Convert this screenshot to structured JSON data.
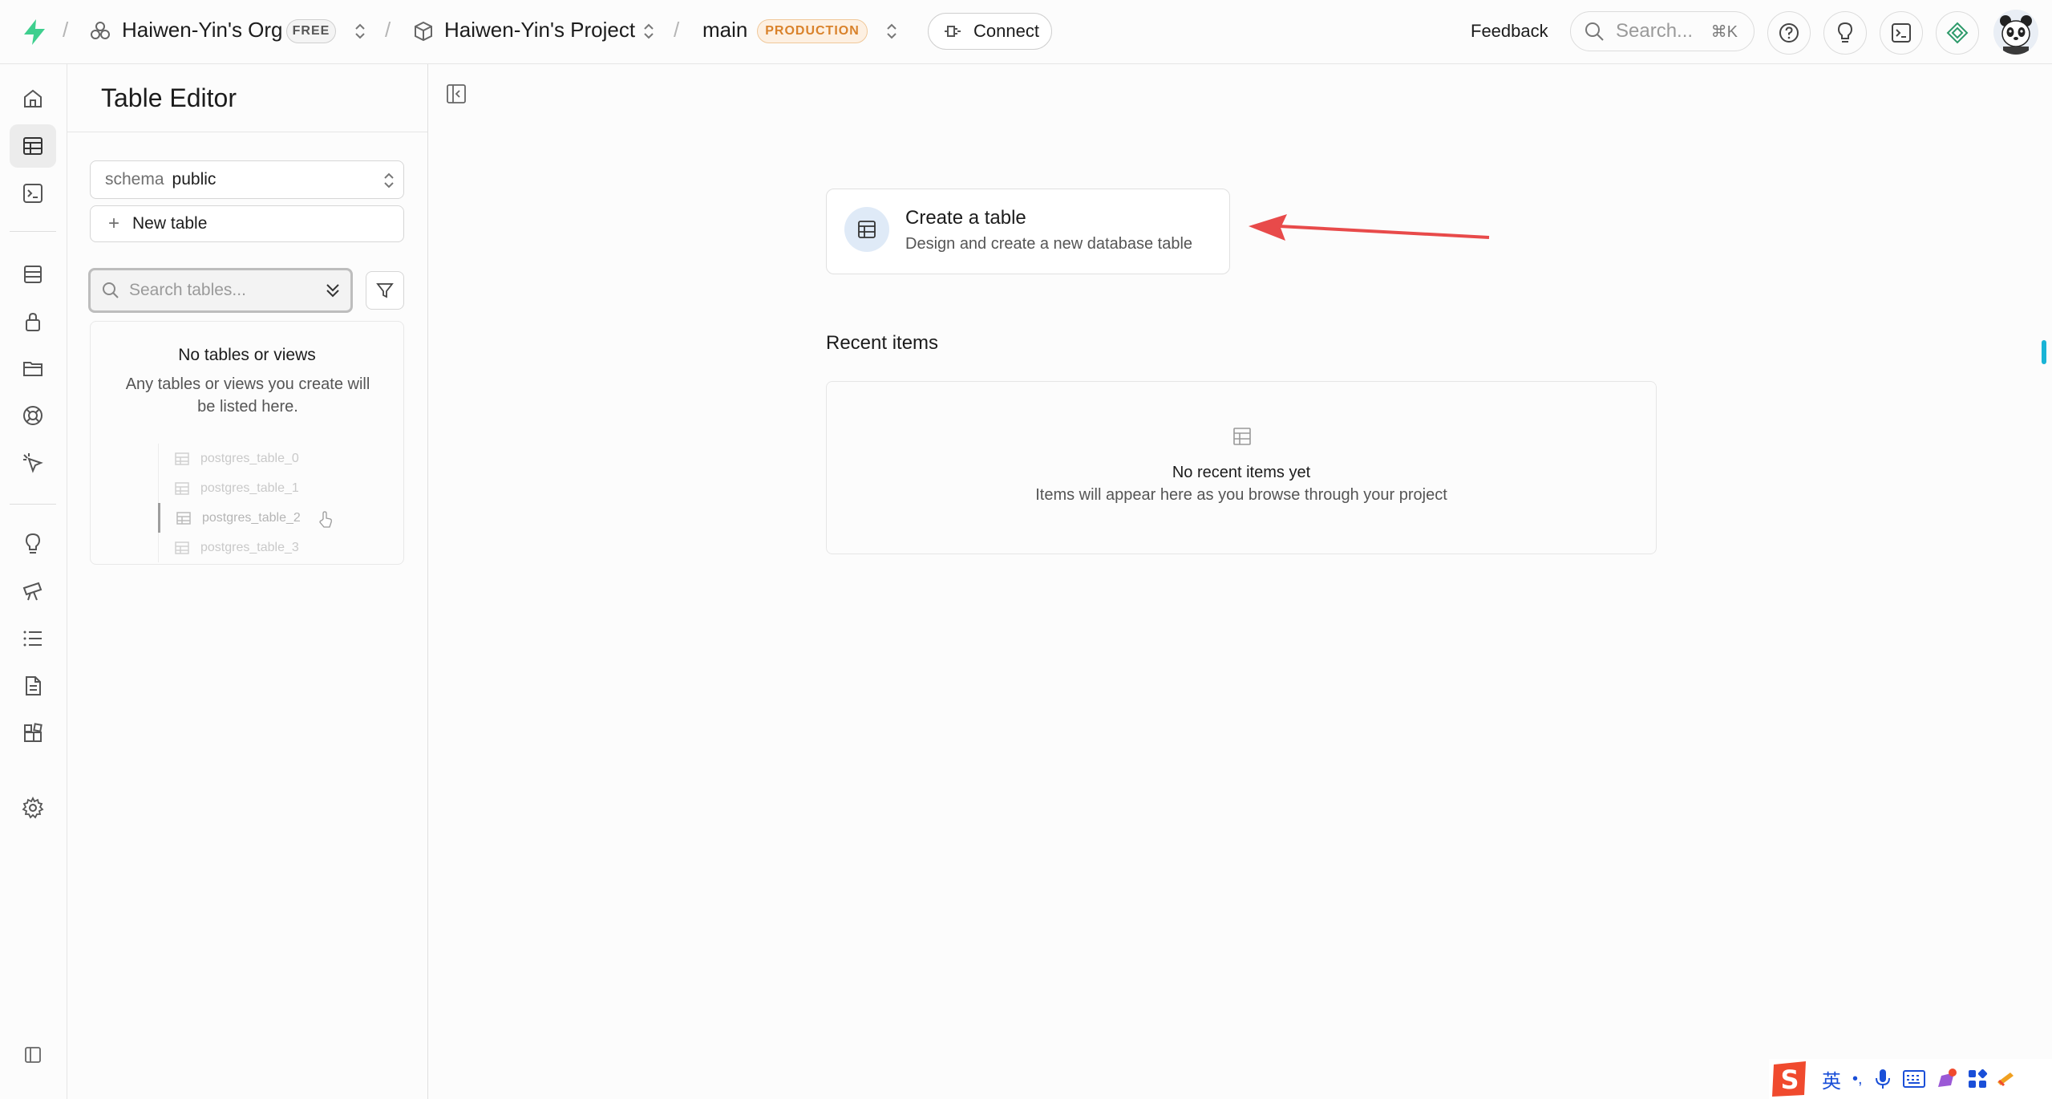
{
  "topbar": {
    "org_name": "Haiwen-Yin's Org",
    "org_plan": "FREE",
    "project_name": "Haiwen-Yin's Project",
    "branch_name": "main",
    "branch_env": "PRODUCTION",
    "connect_label": "Connect",
    "feedback_label": "Feedback",
    "search_placeholder": "Search...",
    "search_shortcut": "⌘K",
    "separator": "/"
  },
  "rail": {
    "items": [
      "home-icon",
      "table-editor-icon",
      "sql-editor-icon",
      "database-icon",
      "auth-icon",
      "storage-icon",
      "realtime-icon",
      "edge-functions-icon",
      "advisors-icon",
      "reports-icon",
      "logs-icon",
      "api-docs-icon",
      "integrations-icon",
      "settings-icon"
    ],
    "active": "table-editor-icon"
  },
  "panel": {
    "title": "Table Editor",
    "schema_label": "schema",
    "schema_value": "public",
    "new_table_label": "New table",
    "search_placeholder": "Search tables...",
    "empty_title": "No tables or views",
    "empty_desc": "Any tables or views you create will be listed here.",
    "ghost_tables": [
      "postgres_table_0",
      "postgres_table_1",
      "postgres_table_2",
      "postgres_table_3"
    ]
  },
  "main": {
    "create_card": {
      "title": "Create a table",
      "description": "Design and create a new database table"
    },
    "recent_title": "Recent items",
    "recent_empty_title": "No recent items yet",
    "recent_empty_desc": "Items will appear here as you browse through your project"
  },
  "ime": {
    "lang": "英",
    "punct": "•,"
  },
  "colors": {
    "brand": "#3ecf8e",
    "production_badge": "#d9822b",
    "arrow": "#e84a4a",
    "scroll_thumb": "#19b4d6"
  }
}
